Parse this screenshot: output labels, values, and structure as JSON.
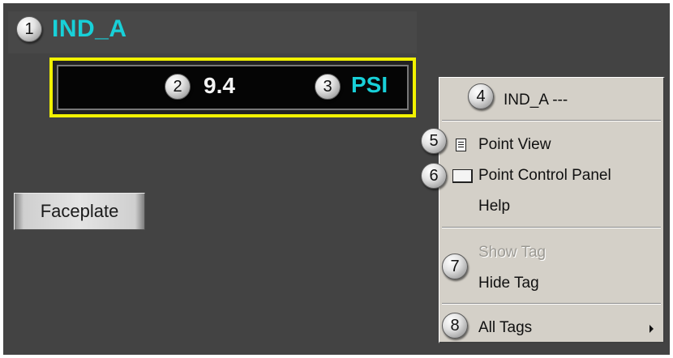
{
  "tag": {
    "name": "IND_A",
    "value": "9.4",
    "unit": "PSI"
  },
  "faceplate_button": {
    "label": "Faceplate"
  },
  "context_menu": {
    "header": "IND_A ---",
    "items": [
      {
        "label": "Point View",
        "icon": "point-view-icon",
        "enabled": true
      },
      {
        "label": "Point Control Panel",
        "icon": "point-control-panel-icon",
        "enabled": true
      },
      {
        "label": "Help",
        "enabled": true
      },
      {
        "label": "Show Tag",
        "enabled": false
      },
      {
        "label": "Hide Tag",
        "enabled": true
      },
      {
        "label": "All Tags",
        "has_submenu": true,
        "enabled": true
      }
    ]
  },
  "callouts": [
    "1",
    "2",
    "3",
    "4",
    "5",
    "6",
    "7",
    "8"
  ],
  "colors": {
    "panel_background": "#434343",
    "tag_text": "#18d0d8",
    "value_text": "#f4f4f4",
    "value_border": "#f2f200",
    "menu_background": "#d4d0c8",
    "disabled_text": "#9c9a94"
  }
}
